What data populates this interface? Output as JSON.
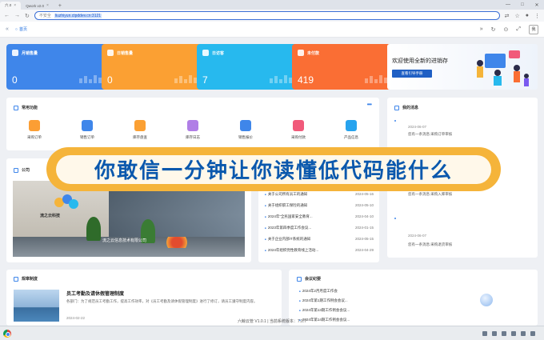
{
  "browser": {
    "tabs": [
      {
        "label": "六.0",
        "active": true
      },
      {
        "label": "Qwork v2.0",
        "active": false
      }
    ],
    "security_label": "不安全",
    "address": "liuzhiyun.ctpddev.cn:3121"
  },
  "app_header": {
    "crumb": "首页",
    "avatar": "我"
  },
  "stats": [
    {
      "label": "月销售量",
      "value": "0",
      "color": "#3f86ea"
    },
    {
      "label": "日销售量",
      "value": "0",
      "color": "#fba033"
    },
    {
      "label": "日访客",
      "value": "7",
      "color": "#27b9ee"
    },
    {
      "label": "未付款",
      "value": "419",
      "color": "#fa6e34"
    }
  ],
  "welcome": {
    "title": "欢迎使用全新的进销存",
    "button": "查看引导手册"
  },
  "common_functions": {
    "title": "常用功能",
    "items": [
      {
        "label": "采购订单",
        "color": "#fb9e34",
        "icon": "purchase-order-icon"
      },
      {
        "label": "销售订单",
        "color": "#3f86ea",
        "icon": "sales-order-icon"
      },
      {
        "label": "库存盘查",
        "color": "#fba033",
        "icon": "inventory-check-icon"
      },
      {
        "label": "库存日志",
        "color": "#b07ee6",
        "icon": "inventory-log-icon"
      },
      {
        "label": "销售报价",
        "color": "#3f86ea",
        "icon": "sales-quote-icon"
      },
      {
        "label": "采购付款",
        "color": "#f15a7a",
        "icon": "purchase-payment-icon"
      },
      {
        "label": "产品信息",
        "color": "#27a3ee",
        "icon": "product-info-icon"
      }
    ]
  },
  "my_messages": {
    "title": "我的消息",
    "items": [
      {
        "date": "2024-06-07",
        "text": "您有一条消息:采购订单审核"
      },
      {
        "date": "2024-06-07",
        "text": "您有一条消息:采购入库审核"
      },
      {
        "date": "2024-06-07",
        "text": "您有一条消息:采购退货审核"
      }
    ]
  },
  "company": {
    "title": "公司",
    "brand": "流之云科技",
    "caption": "流之云信息技术有限公司"
  },
  "notices": {
    "items": [
      {
        "title": "关于公司所有员工的通知",
        "date": "2024-05-16"
      },
      {
        "title": "关于组织职工保险的通知",
        "date": "2024-05-10"
      },
      {
        "title": "2024年“全民国家安全教育...",
        "date": "2024-04-10"
      },
      {
        "title": "2023年第四季度工作会议...",
        "date": "2024-01-15"
      },
      {
        "title": "关于企业内部IT系统的通知",
        "date": "2024-05-15"
      },
      {
        "title": "2024年组织党性教育线上活动...",
        "date": "2024-04-29"
      }
    ]
  },
  "rules": {
    "title": "规章制度",
    "heading": "员工考勤及请休假管理制度",
    "body": "各部门：为了规范员工考勤工作，提高工作效率，对《员工考勤及请休假管理制度》进行了修订，请员工遵守制度内容。",
    "date": "2024-02-22"
  },
  "meetings": {
    "title": "会议纪要",
    "items": [
      "2024年2月月度工作会",
      "2024年第1期工作例会会议...",
      "2024年第13期工作例会会议...",
      "2024年第14期工作例会会议..."
    ]
  },
  "footer": "六鲸云管 V1.0.1 | 当前系统版本：7.0.7",
  "overlay_banner": "你敢信一分钟让你读懂低代码能什么"
}
